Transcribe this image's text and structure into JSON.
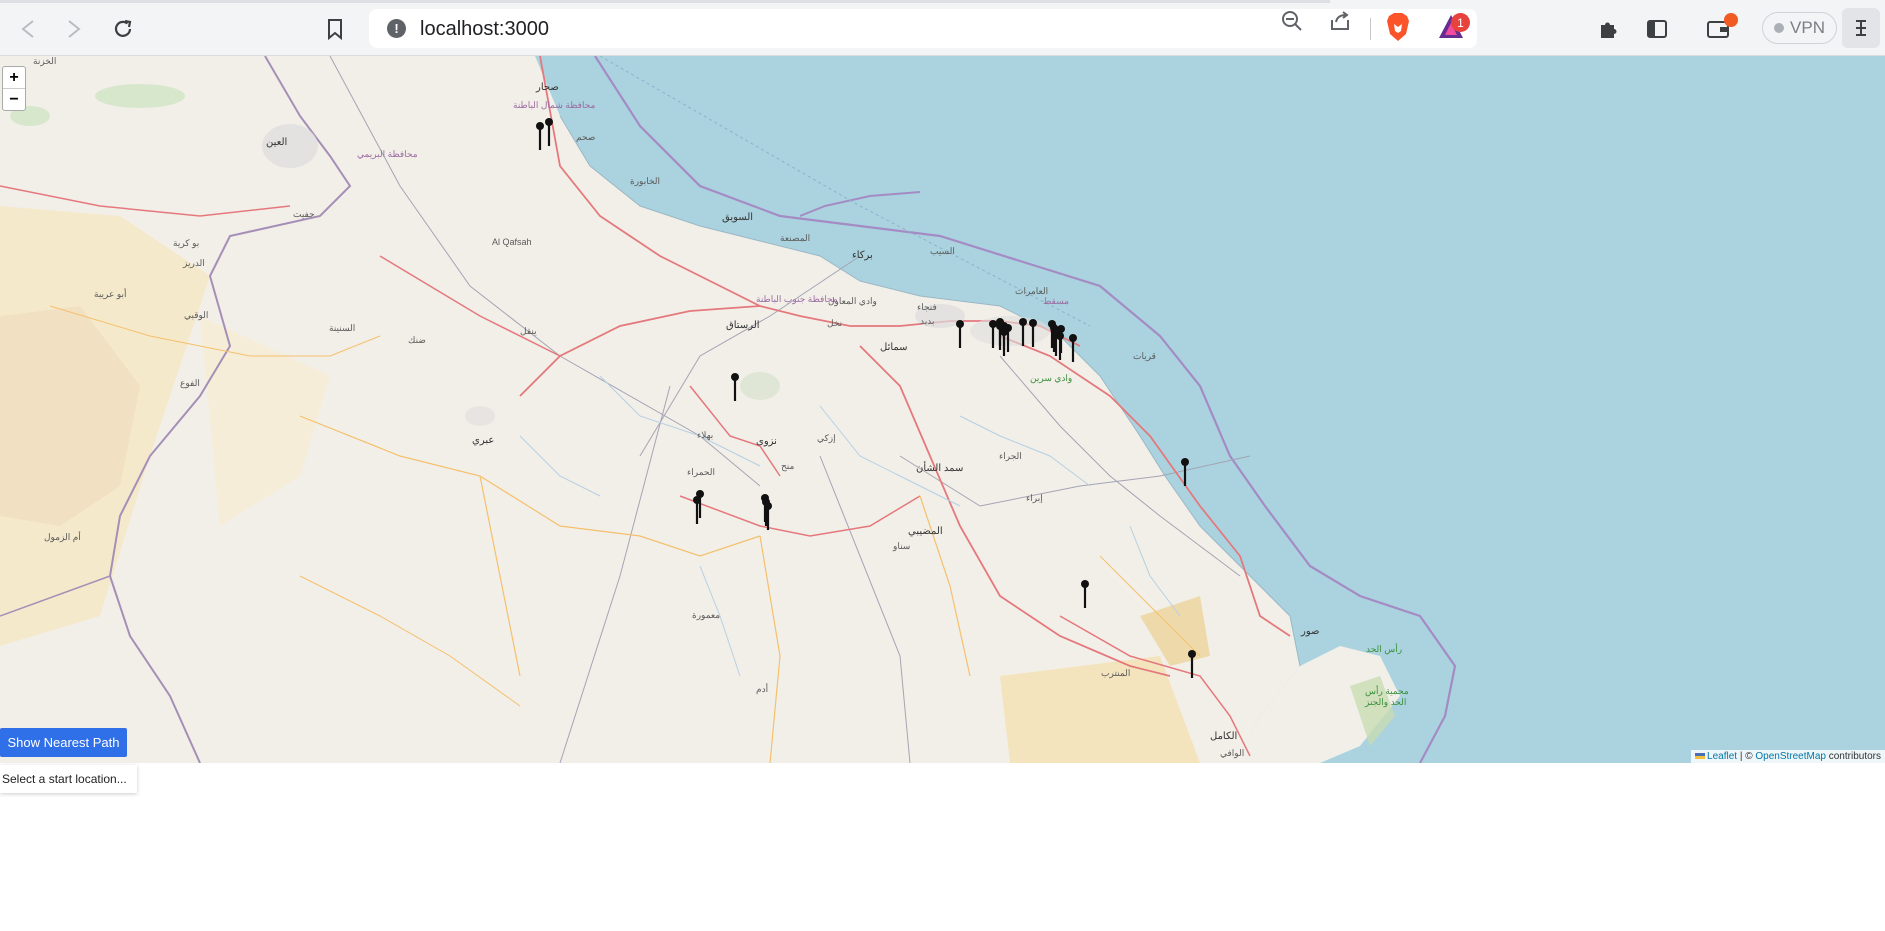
{
  "browser": {
    "url": "localhost:3000",
    "vpn_label": "VPN",
    "rewards_badge": "1",
    "icons": {
      "back": "back-arrow-icon",
      "forward": "forward-arrow-icon",
      "reload": "reload-icon",
      "bookmark": "bookmark-icon",
      "site_info": "info-icon",
      "zoom": "zoom-out-icon",
      "share": "share-icon",
      "extensions": "puzzle-icon",
      "sidebar": "sidebar-icon",
      "wallet": "wallet-icon",
      "menu": "hamburger-menu-icon"
    },
    "colors": {
      "accent": "#e8423c",
      "wallet_dot": "#f25a24"
    }
  },
  "map": {
    "zoom_in": "+",
    "zoom_out": "−",
    "attribution": {
      "leaflet": "Leaflet",
      "separator": " | © ",
      "osm": "OpenStreetMap",
      "suffix": " contributors"
    },
    "places": [
      "صحار",
      "محافظة شمال الباطنة",
      "صحم",
      "الخابورة",
      "السويق",
      "المصنعة",
      "بركاء",
      "السيب",
      "مسقط",
      "العامرات",
      "قريات",
      "وادي سرين",
      "محافظة جنوب الباطنة",
      "وادي المعاول",
      "الرستاق",
      "نخل",
      "سمائل",
      "بدبد",
      "فنجاء",
      "إزكي",
      "نزوى",
      "بهلاء",
      "منح",
      "سمد الشأن",
      "المضيبي",
      "سناو",
      "إبراء",
      "الجراء",
      "المنترب",
      "صور",
      "الكامل",
      "الوافي",
      "رأس الحد",
      "محمية رأس الحد والجنز",
      "الحمراء",
      "معمورة",
      "أدم",
      "عبري",
      "ينقل",
      "ضنك",
      "السنينة",
      "العين",
      "حفيت",
      "محافظة البريمي",
      "Al Qafsah",
      "الدريز",
      "أبو عريبة",
      "الوقبي",
      "الفوع",
      "أم الزمول",
      "الخزنة",
      "بو كرية"
    ],
    "markers_count": 26
  },
  "controls": {
    "show_path_label": "Show Nearest Path",
    "status_text": "Select a start location..."
  }
}
